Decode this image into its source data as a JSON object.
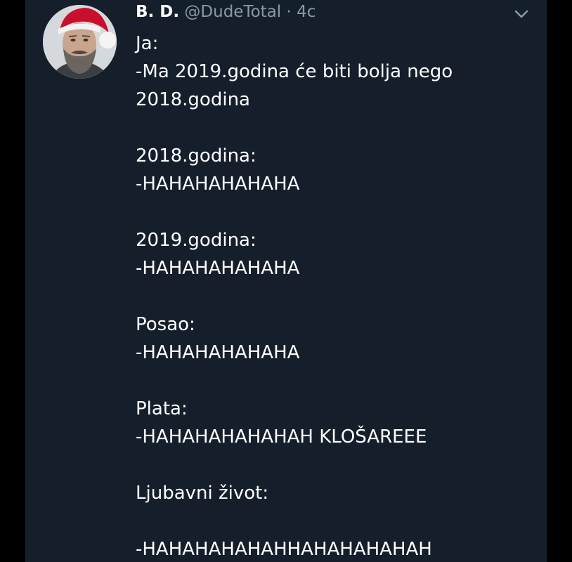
{
  "tweet": {
    "display_name": "B. D.",
    "handle": "@DudeTotal",
    "separator": "·",
    "time": "4c",
    "lines": [
      "Ja:",
      "-Ma 2019.godina će biti bolja nego",
      "2018.godina",
      "",
      "2018.godina:",
      "-HAHAHAHAHAHA",
      "",
      "2019.godina:",
      "-HAHAHAHAHAHA",
      "",
      "Posao:",
      "-HAHAHAHAHAHA",
      "",
      "Plata:",
      "-HAHAHAHAHAHAH KLOŠAREEE",
      "",
      "Ljubavni život:",
      "",
      "-HAHAHAHAHAHHAHAHAHAHAH"
    ]
  },
  "icons": {
    "avatar": "avatar-santa-hat-man",
    "caret": "chevron-down-icon"
  },
  "colors": {
    "background": "#151f2b",
    "outer": "#000000",
    "text": "#ffffff",
    "muted": "#8899a6"
  }
}
